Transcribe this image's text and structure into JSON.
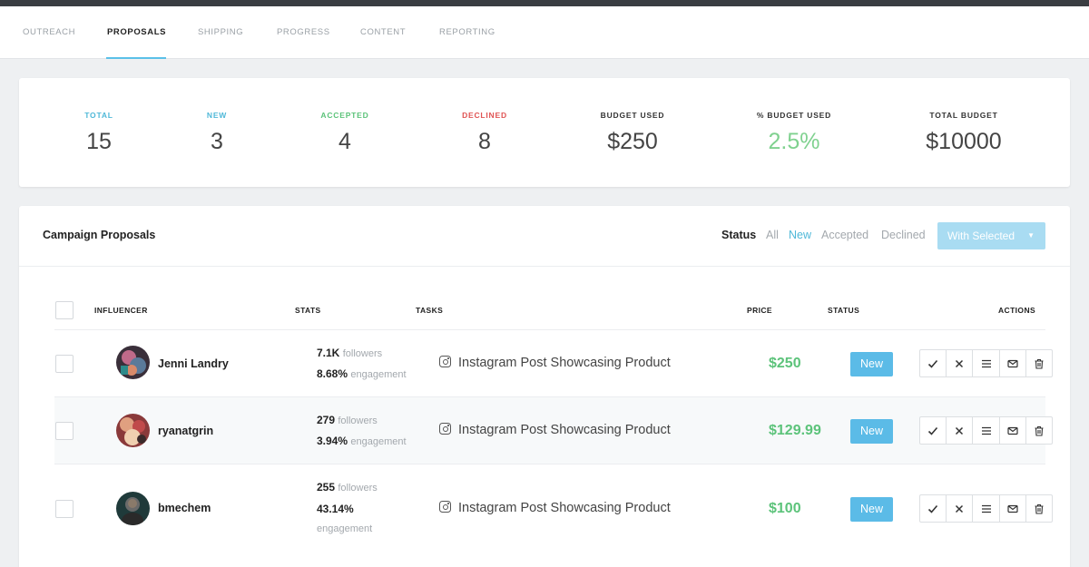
{
  "nav": {
    "tabs": [
      {
        "label": "OUTREACH"
      },
      {
        "label": "PROPOSALS"
      },
      {
        "label": "SHIPPING"
      },
      {
        "label": "PROGRESS"
      },
      {
        "label": "CONTENT"
      },
      {
        "label": "REPORTING"
      }
    ],
    "active_tab": "PROPOSALS"
  },
  "summary": [
    {
      "label": "TOTAL",
      "value": "15",
      "color": "#4fb8d8"
    },
    {
      "label": "NEW",
      "value": "3",
      "color": "#4fb8d8"
    },
    {
      "label": "ACCEPTED",
      "value": "4",
      "color": "#5cc37a"
    },
    {
      "label": "DECLINED",
      "value": "8",
      "color": "#e05454"
    },
    {
      "label": "BUDGET USED",
      "value": "$250",
      "color": "#333333"
    },
    {
      "label": "% BUDGET USED",
      "value": "2.5%",
      "color": "#333333",
      "value_color": "#7fd18f"
    },
    {
      "label": "TOTAL BUDGET",
      "value": "$10000",
      "color": "#333333"
    }
  ],
  "proposals": {
    "title": "Campaign Proposals",
    "filter_label": "Status",
    "filters": [
      {
        "label": "All",
        "color": "#a3a8ad"
      },
      {
        "label": "New",
        "color": "#4fb8d8"
      },
      {
        "label": "Accepted",
        "color": "#a3a8ad"
      },
      {
        "label": "Declined",
        "color": "#a3a8ad"
      }
    ],
    "with_selected": "With Selected",
    "columns": {
      "influencer": "INFLUENCER",
      "stats": "STATS",
      "tasks": "TASKS",
      "price": "PRICE",
      "status": "STATUS",
      "actions": "ACTIONS"
    },
    "rows": [
      {
        "name": "Jenni Landry",
        "followers": "7.1K",
        "followers_unit": "followers",
        "engagement": "8.68%",
        "engagement_unit": "engagement",
        "task": "Instagram Post Showcasing Product",
        "price": "$250",
        "status": "New"
      },
      {
        "name": "ryanatgrin",
        "followers": "279",
        "followers_unit": "followers",
        "engagement": "3.94%",
        "engagement_unit": "engagement",
        "task": "Instagram Post Showcasing Product",
        "price": "$129.99",
        "status": "New"
      },
      {
        "name": "bmechem",
        "followers": "255",
        "followers_unit": "followers",
        "engagement": "43.14%",
        "engagement_unit": "engagement",
        "task": "Instagram Post Showcasing Product",
        "price": "$100",
        "status": "New"
      }
    ],
    "row_actions": [
      "check-icon",
      "close-icon",
      "menu-icon",
      "mail-icon",
      "trash-icon"
    ]
  }
}
